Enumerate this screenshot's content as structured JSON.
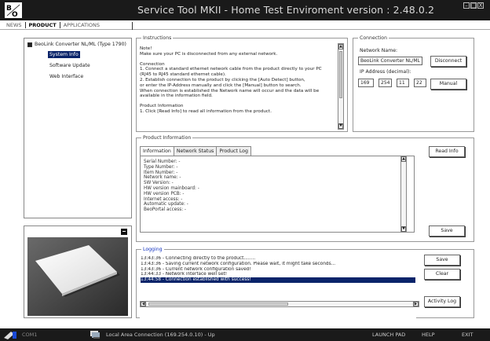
{
  "window": {
    "title": "Service Tool MKII - Home Test Enviroment version : 2.48.0.2",
    "buttons": [
      "–",
      "□",
      "X"
    ]
  },
  "menu": {
    "tabs": [
      {
        "label": "NEWS"
      },
      {
        "label": "PRODUCT"
      },
      {
        "label": "APPLICATIONS"
      }
    ]
  },
  "tree": {
    "root": "BeoLink Converter NL/ML (Type 1790)",
    "items": [
      "System Info",
      "Software Update",
      "Web Interface"
    ]
  },
  "instructions": {
    "legend": "Instructions",
    "paragraphs": [
      "Note!\nMake sure your PC is disconnected from any external network.",
      "Connection\n1. Connect a standard ethernet network cable from the product directly to your PC\n(RJ45 to RJ45 standard ethernet cable).\n2. Establish connection to the product by clicking the [Auto Detect] button,\n   or enter the IP-Address manually and click the [Manual] button to search.\n   When connection is established the Network name will occur and the data will be\navailable in the information field.",
      "Product Information\n1. Click [Read Info] to read all information from the product."
    ]
  },
  "connection": {
    "legend": "Connection",
    "network_name_label": "Network Name:",
    "network_name_value": "BeoLink Converter NL/ML",
    "ip_label": "IP Address (decimal):",
    "ip": [
      "169",
      "254",
      "11",
      "22"
    ],
    "disconnect_label": "Disconnect",
    "manual_label": "Manual"
  },
  "product_info": {
    "legend": "Product Information",
    "tabs": [
      "Information",
      "Network Status",
      "Product Log"
    ],
    "fields": [
      "Serial Number: -",
      "Type Number: -",
      "Item Number: -",
      "Network name: -",
      "SW Version: -",
      "HW version mainboard: -",
      "HW version PCB: -",
      "Internet access: -",
      "Automatic update: -",
      "BeoPortal access: -"
    ],
    "read_info_label": "Read Info",
    "save_label": "Save"
  },
  "logging": {
    "legend": "Logging",
    "lines": [
      "13:43:36 - Connecting directly to the product........",
      "13:43:36 - Saving current network configuration. Please wait, it might take seconds...",
      "13:43:36 - Current network configuration saved!",
      "13:44:33 - Network interface well set!",
      "13:44:58 - Connection established with success!"
    ],
    "save_label": "Save",
    "clear_label": "Clear",
    "activity_log_label": "Activity Log"
  },
  "statusbar": {
    "port": "COM1",
    "connection": "Local Area Connection (169.254.0.10) - Up",
    "launch_pad": "LAUNCH PAD",
    "help": "HELP",
    "exit": "EXIT"
  }
}
